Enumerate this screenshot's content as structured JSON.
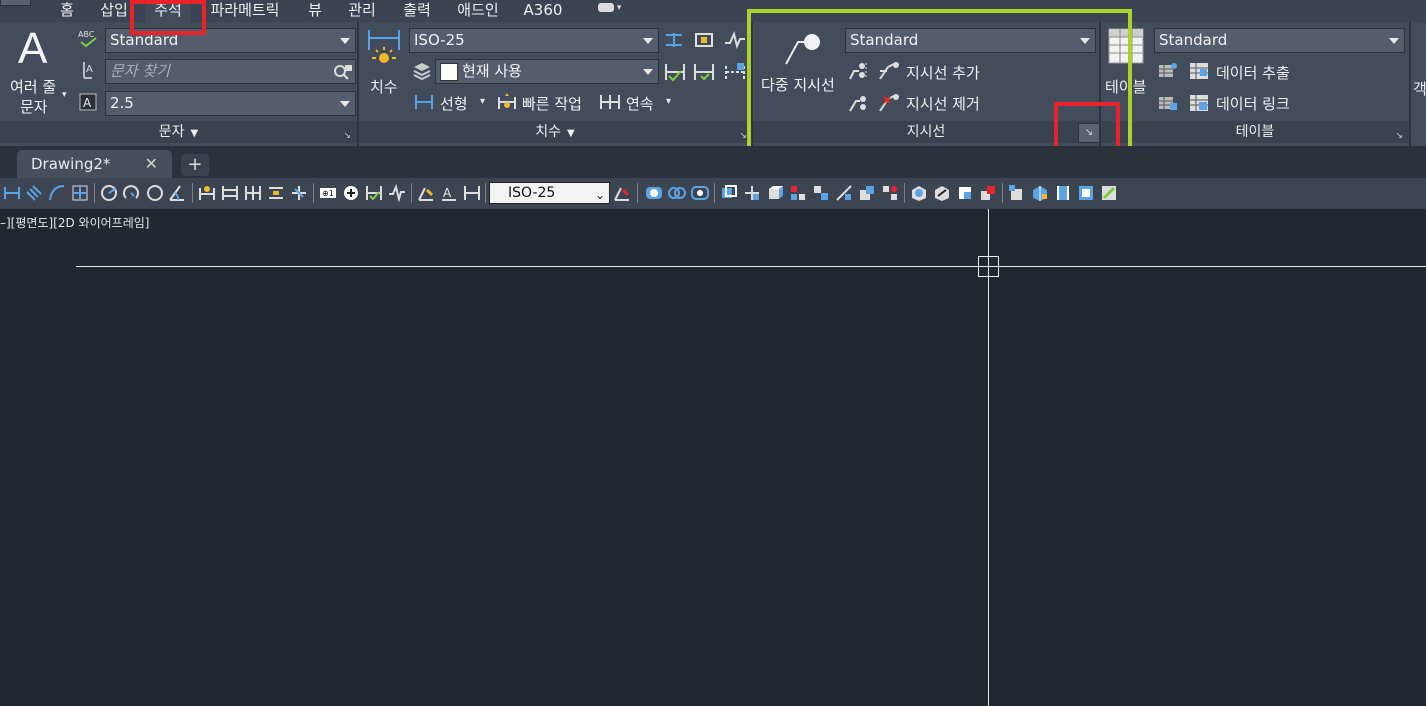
{
  "ribbon_tabs": [
    "홈",
    "삽입",
    "주석",
    "파라메트릭",
    "뷰",
    "관리",
    "출력",
    "애드인",
    "A360"
  ],
  "text_panel": {
    "big_button_line1": "여러 줄",
    "big_button_line2": "문자",
    "big_glyph": "A",
    "style_combo": "Standard",
    "find_placeholder": "문자 찾기",
    "height_combo": "2.5",
    "title": "문자",
    "abc_label": "ABC"
  },
  "dim_panel": {
    "big_button": "치수",
    "style_combo": "ISO-25",
    "layer_combo": "현재 사용",
    "linear": "선형",
    "quick": "빠른 작업",
    "continue": "연속",
    "title": "치수"
  },
  "leader_panel": {
    "big_button": "다중 지시선",
    "style_combo": "Standard",
    "add": "지시선 추가",
    "remove": "지시선 제거",
    "title": "지시선"
  },
  "table_panel": {
    "big_button": "테이블",
    "style_combo": "Standard",
    "extract": "데이터 추출",
    "link": "데이터 링크",
    "title": "테이블",
    "cut_label": "객"
  },
  "file_tab": {
    "name": "Drawing2*",
    "close": "✕",
    "add": "+"
  },
  "toolbar": {
    "dimstyle_combo": "ISO-25"
  },
  "viewport": {
    "label": "–][평면도][2D 와이어프레임]"
  },
  "colors": {
    "highlight_red": "#e8242a",
    "highlight_green": "#a8d32c",
    "canvas_bg": "#212830",
    "ribbon_bg": "#434c5b"
  }
}
